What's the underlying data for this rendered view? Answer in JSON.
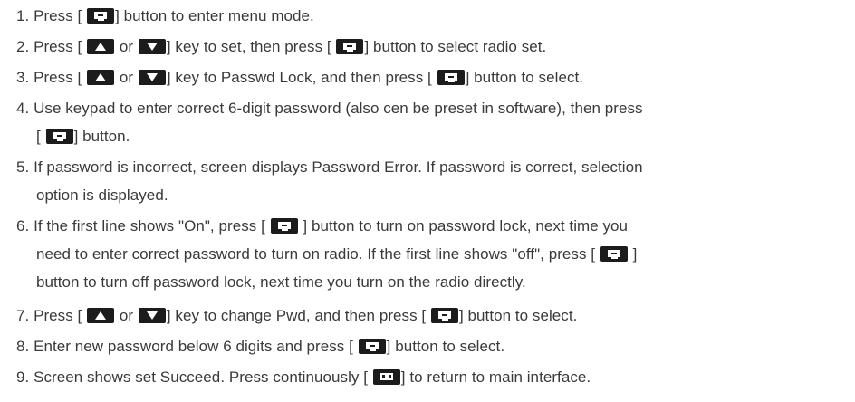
{
  "steps": [
    {
      "n": "1.",
      "parts": [
        "Press [",
        "] button to enter menu mode."
      ]
    },
    {
      "n": "2.",
      "parts": [
        "Press [",
        "or",
        "] key to set, then press [",
        "] button to select radio set."
      ]
    },
    {
      "n": "3.",
      "parts": [
        "Press [",
        "or",
        "] key to Passwd Lock, and then press [",
        "] button to select."
      ]
    },
    {
      "n": "4.",
      "line1": "Use keypad to enter correct 6-digit password (also cen be preset in software), then press",
      "line2_parts": [
        "[",
        "] button."
      ]
    },
    {
      "n": "5.",
      "line1": "If password is incorrect, screen displays Password Error. If password is correct, selection",
      "line2": "option is displayed."
    },
    {
      "n": "6.",
      "line1_parts": [
        "If the first line shows \"On\", press [",
        "] button to turn on password lock, next time you"
      ],
      "line2_parts": [
        "need to enter correct password to turn on radio. If the first line shows \"off\", press [",
        "]"
      ],
      "line3": "button to turn off password lock, next time you turn on the radio directly."
    },
    {
      "n": "7.",
      "parts": [
        "Press [",
        "or",
        "] key to change Pwd, and then press [",
        "] button to select."
      ]
    },
    {
      "n": "8.",
      "parts": [
        "Enter new password below 6 digits and press [",
        "] button to select."
      ]
    },
    {
      "n": "9.",
      "parts": [
        "Screen shows set Succeed. Press continuously [",
        "] to return to main interface."
      ]
    }
  ],
  "icons": {
    "menu": "menu-key-icon",
    "up": "up-arrow-key-icon",
    "down": "down-arrow-key-icon",
    "return": "return-key-icon"
  },
  "colors": {
    "text": "#3a3a3a",
    "key": "#1c1c1c"
  }
}
